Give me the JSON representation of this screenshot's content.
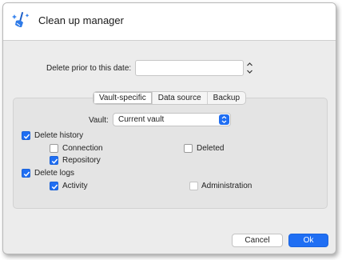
{
  "window": {
    "title": "Clean up manager",
    "app_icon": "broom-sparkle-icon"
  },
  "date_filter": {
    "label": "Delete prior to this date:",
    "value": ""
  },
  "tabs": [
    {
      "label": "Vault-specific",
      "active": true
    },
    {
      "label": "Data source",
      "active": false
    },
    {
      "label": "Backup",
      "active": false
    }
  ],
  "vault": {
    "label": "Vault:",
    "selected": "Current vault"
  },
  "options": {
    "delete_history": {
      "label": "Delete history",
      "checked": true
    },
    "connection": {
      "label": "Connection",
      "checked": false
    },
    "deleted": {
      "label": "Deleted",
      "checked": false
    },
    "repository": {
      "label": "Repository",
      "checked": true
    },
    "delete_logs": {
      "label": "Delete logs",
      "checked": true
    },
    "activity": {
      "label": "Activity",
      "checked": true
    },
    "administration": {
      "label": "Administration",
      "checked": false
    }
  },
  "buttons": {
    "cancel": "Cancel",
    "ok": "Ok"
  },
  "colors": {
    "accent": "#1f6ef3",
    "window_bg": "#ececec",
    "group_bg": "#e4e4e4"
  }
}
